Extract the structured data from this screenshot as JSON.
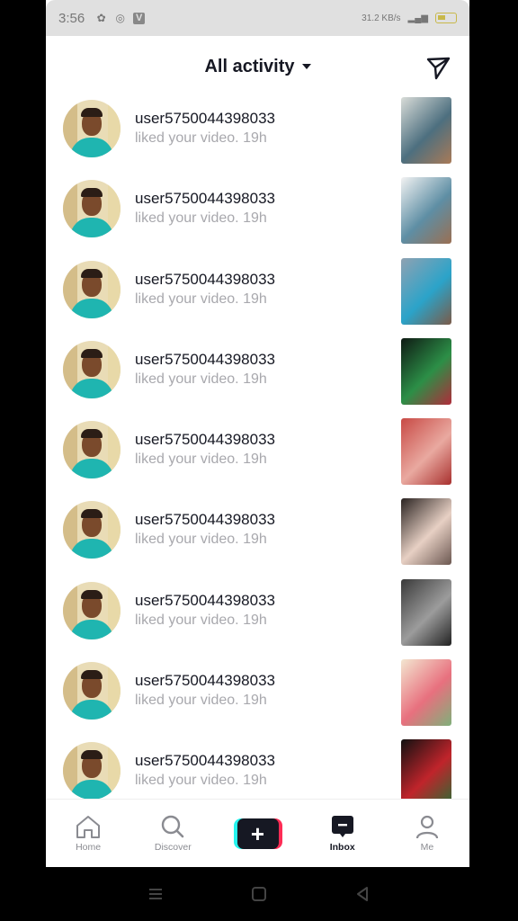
{
  "status_bar": {
    "time": "3:56",
    "network_speed": "31.2 KB/s",
    "indicator_box": "V"
  },
  "header": {
    "title": "All activity"
  },
  "notifications": [
    {
      "username": "user5750044398033",
      "action": "liked your video.",
      "time": "19h",
      "thumb_colors": [
        "#d9dcd8",
        "#4d6f7f",
        "#a97a57"
      ]
    },
    {
      "username": "user5750044398033",
      "action": "liked your video.",
      "time": "19h",
      "thumb_colors": [
        "#f2f2f2",
        "#5e8ea4",
        "#9a6f52"
      ]
    },
    {
      "username": "user5750044398033",
      "action": "liked your video.",
      "time": "19h",
      "thumb_colors": [
        "#8fa2b2",
        "#2ba3c9",
        "#7b5a48"
      ]
    },
    {
      "username": "user5750044398033",
      "action": "liked your video.",
      "time": "19h",
      "thumb_colors": [
        "#0f1a14",
        "#2c8f47",
        "#b02c3a"
      ]
    },
    {
      "username": "user5750044398033",
      "action": "liked your video.",
      "time": "19h",
      "thumb_colors": [
        "#c84a45",
        "#e9a9a0",
        "#a8302e"
      ]
    },
    {
      "username": "user5750044398033",
      "action": "liked your video.",
      "time": "19h",
      "thumb_colors": [
        "#2a2321",
        "#e7d0c4",
        "#6b5750"
      ]
    },
    {
      "username": "user5750044398033",
      "action": "liked your video.",
      "time": "19h",
      "thumb_colors": [
        "#3a3a3a",
        "#9c9c9c",
        "#222222"
      ]
    },
    {
      "username": "user5750044398033",
      "action": "liked your video.",
      "time": "19h",
      "thumb_colors": [
        "#f3e6d0",
        "#e8707e",
        "#7fb07a"
      ]
    },
    {
      "username": "user5750044398033",
      "action": "liked your video.",
      "time": "19h",
      "thumb_colors": [
        "#111111",
        "#c0242b",
        "#2d6b34"
      ]
    }
  ],
  "tabs": [
    {
      "label": "Home",
      "icon": "home-icon"
    },
    {
      "label": "Discover",
      "icon": "search-icon"
    },
    {
      "label": "",
      "icon": "plus-icon"
    },
    {
      "label": "Inbox",
      "icon": "inbox-icon",
      "active": true
    },
    {
      "label": "Me",
      "icon": "profile-icon"
    }
  ],
  "colors": {
    "accent_cyan": "#25f4ee",
    "accent_pink": "#fe2c55",
    "text_primary": "#161823",
    "text_secondary": "#a8a8ad"
  }
}
